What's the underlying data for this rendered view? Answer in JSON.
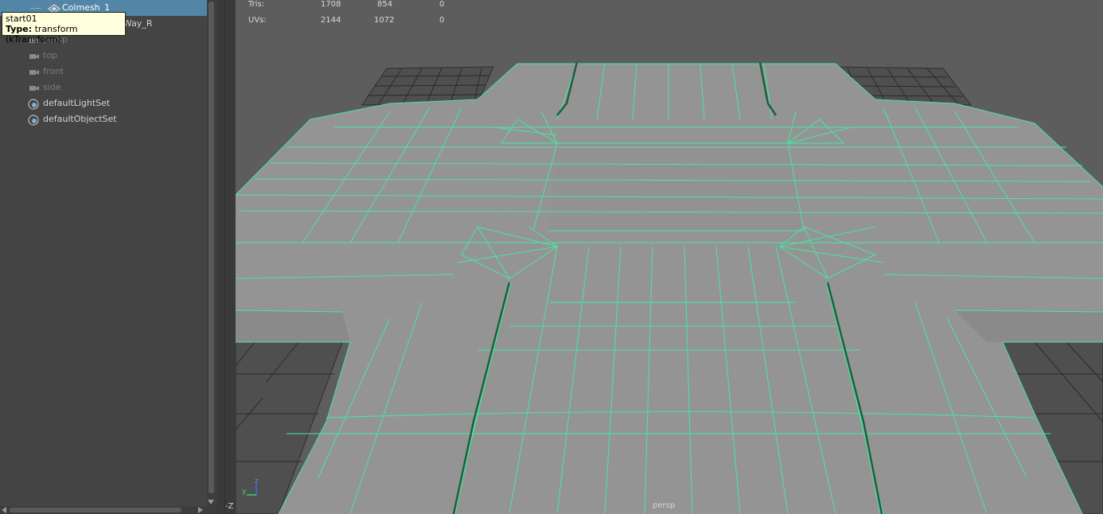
{
  "outliner": {
    "items": [
      {
        "label": "Colmesh_1",
        "state": "selected"
      },
      {
        "label": "TwoLane_FourWay_R",
        "state": "normal"
      },
      {
        "label": "persp",
        "state": "dim"
      },
      {
        "label": "top",
        "state": "dim"
      },
      {
        "label": "front",
        "state": "dim"
      },
      {
        "label": "side",
        "state": "dim"
      },
      {
        "label": "defaultLightSet",
        "state": "normal"
      },
      {
        "label": "defaultObjectSet",
        "state": "normal"
      }
    ]
  },
  "tooltip": {
    "name": "start01",
    "type_label": "Type:",
    "type_value": "transform (kTransform)"
  },
  "hud": {
    "rows": [
      {
        "label": "Tris:",
        "a": "1708",
        "b": "854",
        "c": "0"
      },
      {
        "label": "UVs:",
        "a": "2144",
        "b": "1072",
        "c": "0"
      }
    ]
  },
  "viewport": {
    "camera_label": "persp",
    "axis_labels": {
      "z": "z",
      "y": "y",
      "neg_z": "-Z"
    }
  },
  "colors": {
    "wireframe": "#47e6a4",
    "selection": "#5285a6",
    "panel": "#444444",
    "viewport_bg": "#5d5d5d",
    "mesh": "#949494"
  }
}
